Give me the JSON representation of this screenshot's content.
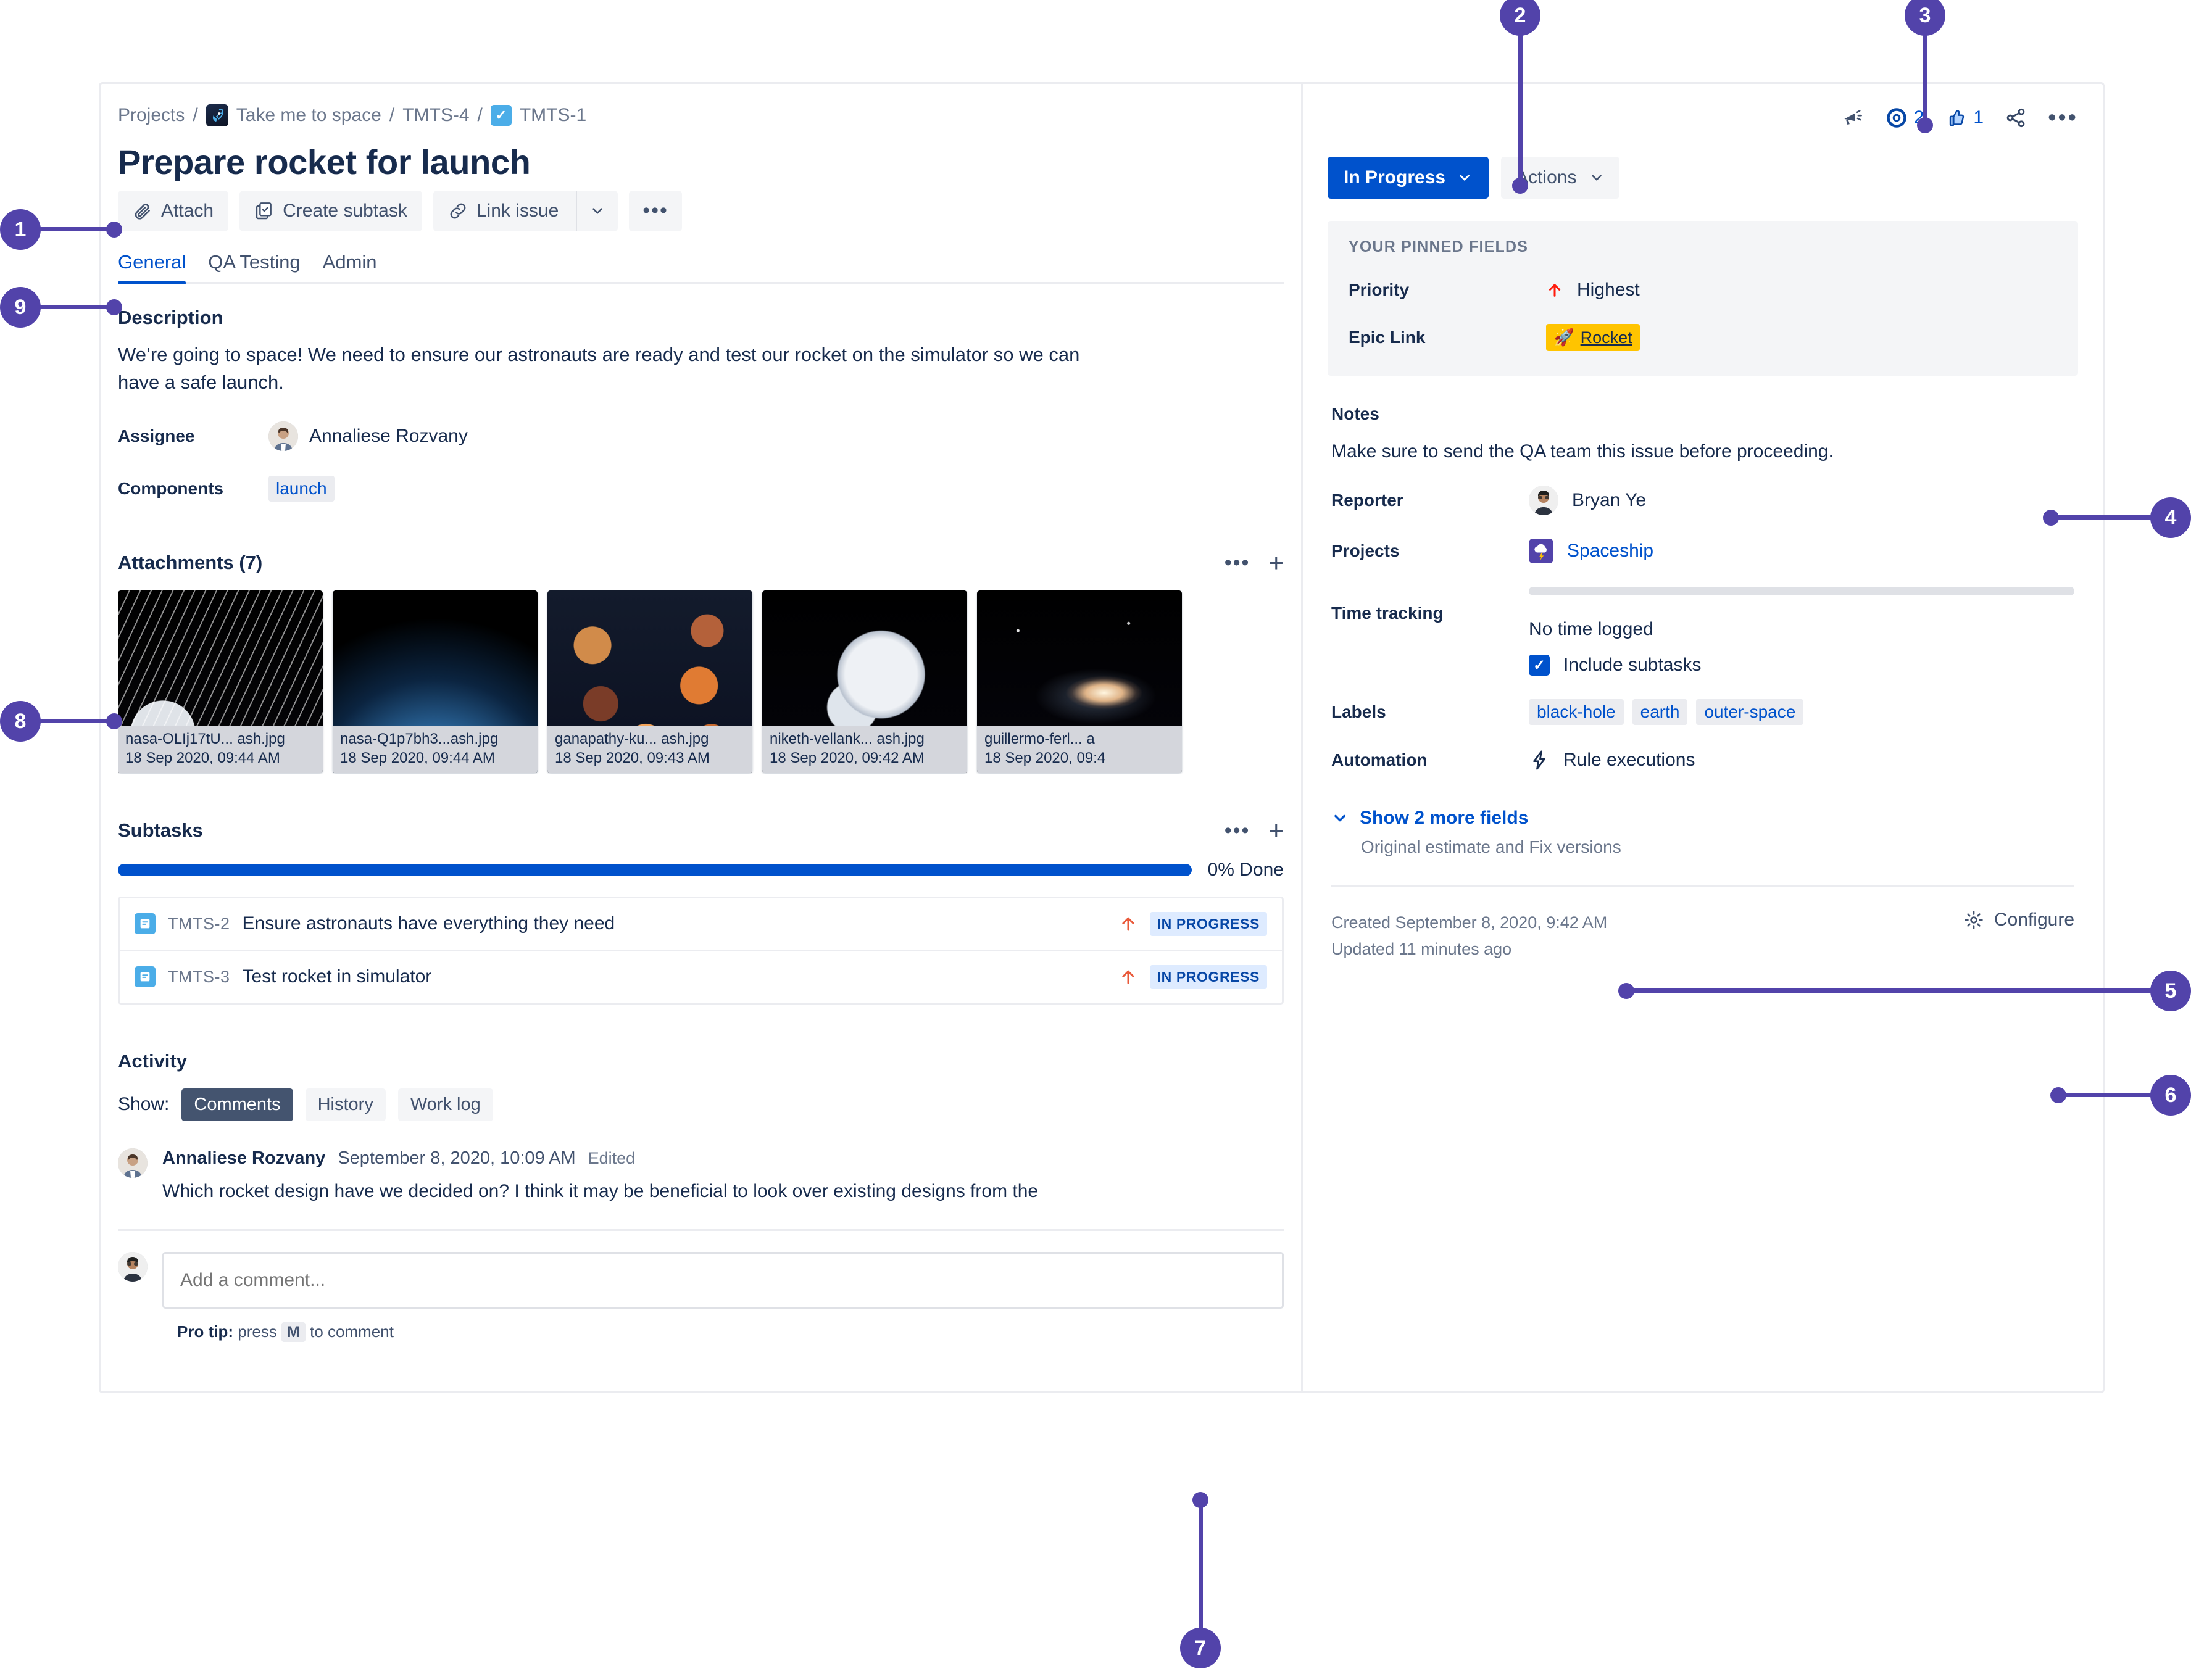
{
  "breadcrumb": {
    "projects": "Projects",
    "project_name": "Take me to space",
    "parent_key": "TMTS-4",
    "issue_key": "TMTS-1"
  },
  "title": "Prepare rocket for launch",
  "actions": {
    "attach": "Attach",
    "create_subtask": "Create subtask",
    "link_issue": "Link issue",
    "more": "•••"
  },
  "tabs": [
    {
      "label": "General",
      "active": true
    },
    {
      "label": "QA Testing",
      "active": false
    },
    {
      "label": "Admin",
      "active": false
    }
  ],
  "description": {
    "heading": "Description",
    "body": "We’re going to space! We need to ensure our astronauts are ready and test our rocket on the simulator so we can have a safe launch."
  },
  "fields": {
    "assignee_label": "Assignee",
    "assignee_value": "Annaliese Rozvany",
    "components_label": "Components",
    "components_value": "launch"
  },
  "attachments": {
    "heading": "Attachments (7)",
    "items": [
      {
        "name": "nasa-OLIj17tU... ash.jpg",
        "date": "18 Sep 2020, 09:44 AM",
        "thumb": "t-iss"
      },
      {
        "name": "nasa-Q1p7bh3...ash.jpg",
        "date": "18 Sep 2020, 09:44 AM",
        "thumb": "t-earth"
      },
      {
        "name": "ganapathy-ku...  ash.jpg",
        "date": "18 Sep 2020, 09:43 AM",
        "thumb": "t-moon"
      },
      {
        "name": "niketh-vellank... ash.jpg",
        "date": "18 Sep 2020, 09:42 AM",
        "thumb": "t-astro"
      },
      {
        "name": "guillermo-ferl...  a",
        "date": "18 Sep 2020, 09:4",
        "thumb": "t-galaxy"
      }
    ]
  },
  "subtasks": {
    "heading": "Subtasks",
    "progress_label": "0% Done",
    "progress_percent": 0,
    "rows": [
      {
        "key": "TMTS-2",
        "title": "Ensure astronauts have everything they need",
        "status": "IN PROGRESS",
        "priority": "highest"
      },
      {
        "key": "TMTS-3",
        "title": "Test rocket in simulator",
        "status": "IN PROGRESS",
        "priority": "highest"
      }
    ]
  },
  "activity": {
    "heading": "Activity",
    "show_label": "Show:",
    "filters": [
      {
        "label": "Comments",
        "active": true
      },
      {
        "label": "History",
        "active": false
      },
      {
        "label": "Work log",
        "active": false
      }
    ],
    "comment": {
      "author": "Annaliese Rozvany",
      "timestamp": "September 8, 2020, 10:09 AM",
      "edited": "Edited",
      "body": "Which rocket design have we decided on? I think it may be beneficial to look over existing designs from the"
    },
    "comment_placeholder": "Add a comment...",
    "protip_prefix": "Pro tip:",
    "protip_mid": "press",
    "protip_key": "M",
    "protip_suffix": "to comment"
  },
  "header_icons": {
    "feedback": "megaphone-icon",
    "watch_count": "2",
    "like_count": "1"
  },
  "status": {
    "current": "In Progress",
    "actions_label": "Actions"
  },
  "pinned": {
    "title": "YOUR PINNED FIELDS",
    "rows": [
      {
        "label": "Priority",
        "value": "Highest",
        "type": "priority"
      },
      {
        "label": "Epic Link",
        "value": "Rocket",
        "type": "epic"
      }
    ]
  },
  "details": {
    "notes_label": "Notes",
    "notes_value": "Make sure to send the QA team this issue before proceeding.",
    "reporter_label": "Reporter",
    "reporter_value": "Bryan Ye",
    "projects_label": "Projects",
    "projects_value": "Spaceship",
    "time_tracking_label": "Time tracking",
    "time_tracking_value": "No time logged",
    "include_subtasks_label": "Include subtasks",
    "labels_label": "Labels",
    "labels": [
      "black-hole",
      "earth",
      "outer-space"
    ],
    "automation_label": "Automation",
    "automation_value": "Rule executions"
  },
  "show_more": {
    "link": "Show 2 more fields",
    "sub": "Original estimate and Fix versions"
  },
  "footer": {
    "created": "Created September 8, 2020, 9:42 AM",
    "updated": "Updated 11 minutes ago",
    "configure": "Configure"
  },
  "callouts": [
    {
      "n": "1"
    },
    {
      "n": "2"
    },
    {
      "n": "3"
    },
    {
      "n": "4"
    },
    {
      "n": "5"
    },
    {
      "n": "6"
    },
    {
      "n": "7"
    },
    {
      "n": "8"
    },
    {
      "n": "9"
    }
  ],
  "colors": {
    "callout": "#5243AA",
    "primary": "#0052CC",
    "epic": "#FFC400",
    "priority_highest": "#E9593A",
    "task_blue": "#4BADE8"
  }
}
